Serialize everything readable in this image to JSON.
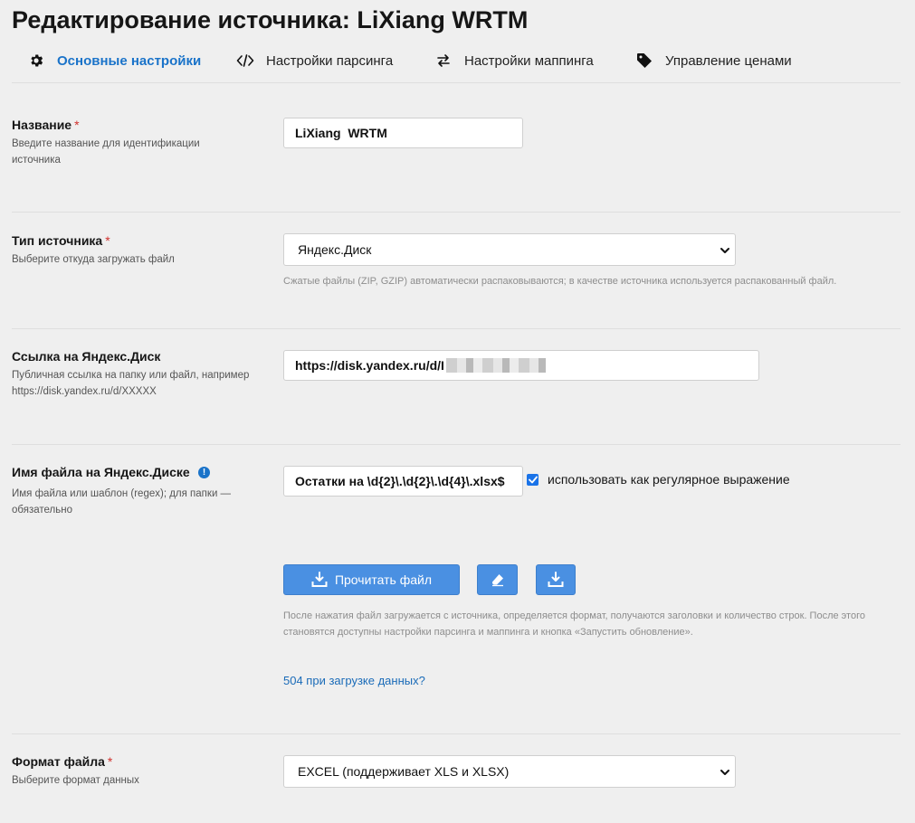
{
  "page": {
    "title": "Редактирование источника: LiXiang WRTM"
  },
  "tabs": [
    {
      "label": "Основные настройки",
      "icon": "gear-icon",
      "active": true
    },
    {
      "label": "Настройки парсинга",
      "icon": "code-icon",
      "active": false
    },
    {
      "label": "Настройки маппинга",
      "icon": "swap-arrows-icon",
      "active": false
    },
    {
      "label": "Управление ценами",
      "icon": "price-tag-icon",
      "active": false
    }
  ],
  "fields": {
    "name": {
      "label": "Название",
      "required_mark": "*",
      "description": "Введите название для идентификации источника",
      "value": "LiXiang  WRTM"
    },
    "source_type": {
      "label": "Тип источника",
      "required_mark": "*",
      "description": "Выберите откуда загружать файл",
      "selected": "Яндекс.Диск",
      "hint": "Сжатые файлы (ZIP, GZIP) автоматически распаковываются; в качестве источника используется распакованный файл."
    },
    "yandex_link": {
      "label": "Ссылка на Яндекс.Диск",
      "description": "Публичная ссылка на папку или файл, например https://disk.yandex.ru/d/XXXXX",
      "value": "https://disk.yandex.ru/d/I"
    },
    "yandex_filename": {
      "label": "Имя файла на Яндекс.Диске",
      "info": "!",
      "description": "Имя файла или шаблон (regex); для папки — обязательно",
      "value": "Остатки на \\d{2}\\.\\d{2}\\.\\d{4}\\.xlsx$",
      "regex_checkbox_label": "использовать как регулярное выражение",
      "regex_checked": true
    },
    "file_format": {
      "label": "Формат файла",
      "required_mark": "*",
      "description": "Выберите формат данных",
      "selected": "EXCEL (поддерживает XLS и XLSX)"
    }
  },
  "actions": {
    "read_file_label": "Прочитать файл",
    "read_hint": "После нажатия файл загружается с источника, определяется формат, получаются заголовки и количество строк. После этого становятся доступны настройки парсинга и маппинга и кнопка «Запустить обновление».",
    "error_link": "504 при загрузке данных?"
  },
  "colors": {
    "accent": "#1a73c9",
    "button": "#4a90e2",
    "required": "#d0312d"
  }
}
